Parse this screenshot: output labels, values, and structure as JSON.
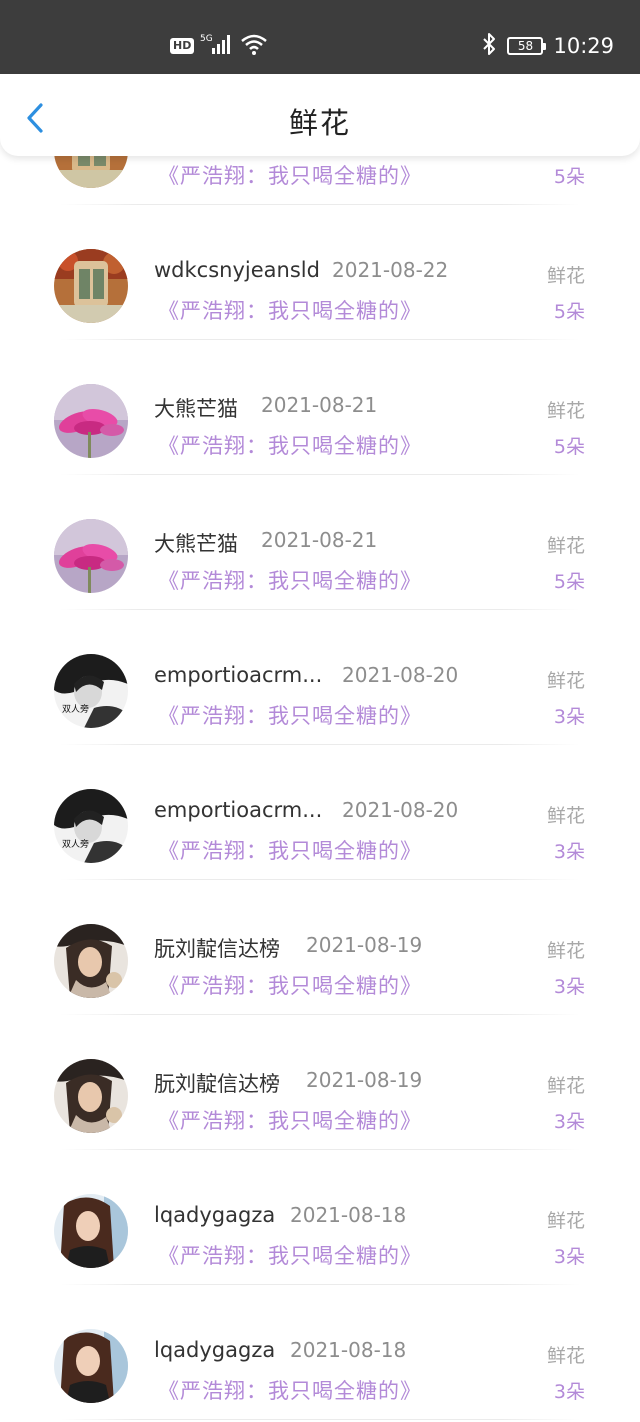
{
  "status_bar": {
    "hd": "HD",
    "net": "5G",
    "battery": "58",
    "time": "10:29"
  },
  "header": {
    "title": "鲜花"
  },
  "records": [
    {
      "user": "",
      "date": "",
      "work": "《严浩翔：我只喝全糖的》",
      "gift": "",
      "count": "5朵",
      "avatar": "garden"
    },
    {
      "user": "wdkcsnyjeansld",
      "date": "2021-08-22",
      "work": "《严浩翔：我只喝全糖的》",
      "gift": "鲜花",
      "count": "5朵",
      "avatar": "garden"
    },
    {
      "user": "大熊芒猫",
      "date": "2021-08-21",
      "work": "《严浩翔：我只喝全糖的》",
      "gift": "鲜花",
      "count": "5朵",
      "avatar": "flower"
    },
    {
      "user": "大熊芒猫",
      "date": "2021-08-21",
      "work": "《严浩翔：我只喝全糖的》",
      "gift": "鲜花",
      "count": "5朵",
      "avatar": "flower"
    },
    {
      "user": "emportioacrm...",
      "date": "2021-08-20",
      "work": "《严浩翔：我只喝全糖的》",
      "gift": "鲜花",
      "count": "3朵",
      "avatar": "bw"
    },
    {
      "user": "emportioacrm...",
      "date": "2021-08-20",
      "work": "《严浩翔：我只喝全糖的》",
      "gift": "鲜花",
      "count": "3朵",
      "avatar": "bw"
    },
    {
      "user": "朊刘靛信达榜",
      "date": "2021-08-19",
      "work": "《严浩翔：我只喝全糖的》",
      "gift": "鲜花",
      "count": "3朵",
      "avatar": "girl-hat"
    },
    {
      "user": "朊刘靛信达榜",
      "date": "2021-08-19",
      "work": "《严浩翔：我只喝全糖的》",
      "gift": "鲜花",
      "count": "3朵",
      "avatar": "girl-hat"
    },
    {
      "user": "lqadygagza",
      "date": "2021-08-18",
      "work": "《严浩翔：我只喝全糖的》",
      "gift": "鲜花",
      "count": "3朵",
      "avatar": "girl-hair"
    },
    {
      "user": "lqadygagza",
      "date": "2021-08-18",
      "work": "《严浩翔：我只喝全糖的》",
      "gift": "鲜花",
      "count": "3朵",
      "avatar": "girl-hair"
    }
  ]
}
